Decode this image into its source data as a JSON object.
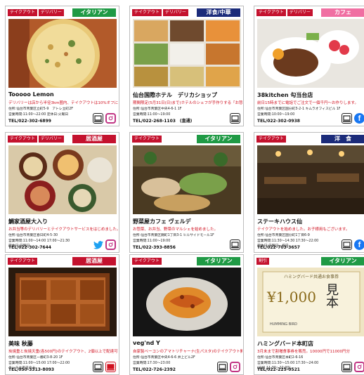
{
  "colors": {
    "tag": "#c4122e",
    "italian": "#1f9a45",
    "western_chinese": "#1b2b7a",
    "cafe": "#f06fa2",
    "izakaya": "#c4122e",
    "western": "#1b2b7a"
  },
  "cards": [
    {
      "tags": [
        "テイクアウト",
        "デリバリー"
      ],
      "category": "イタリアン",
      "name": "Tooooo Lemon",
      "desc": "デリバリーは店から半径3km圏内、テイクアウトは10%オフに。",
      "info": [
        "住所:仙台市青葉区立町5-9　アトレ立町2F",
        "営業時間:11:00〜22:00 定休日:火曜日"
      ],
      "tel": "TEL/022-302-6899",
      "icons": [
        "web-icon",
        "instagram-icon"
      ]
    },
    {
      "tags": [
        "テイクアウト",
        "デリバリー"
      ],
      "category": "洋食/中華",
      "name": "仙台国際ホテル　デリカショップ",
      "desc": "期間限定(5月31日(日)まで)ホテルのシェフが手作りする「お惣菜」販売中。",
      "info": [
        "住所:仙台市青葉区中央4-6-1 1F",
        "営業時間:11:00〜19:00"
      ],
      "tel": "TEL/022-268-1103　(直通)",
      "icons": [
        "web-icon"
      ]
    },
    {
      "tags": [
        "テイクアウト",
        "デリバリー"
      ],
      "category": "カフェ",
      "name": "38kitchen 勾当台店",
      "desc": "前日15時までに電話でご注文で一個千円〜お作りします。",
      "info": [
        "住所:仙台市青葉区国分町3-2-1 キムラオフィスビル 1F",
        "営業時間:10:00〜19:00"
      ],
      "tel": "TEL/022-302-0938",
      "icons": [
        "web-icon",
        "facebook-icon"
      ]
    },
    {
      "tags": [
        "テイクアウト",
        "デリバリー"
      ],
      "category": "居酒屋",
      "name": "鯛家酒屋大入り",
      "desc": "お弁当等のデリバリーとテイクアウトサービスをはじめました。",
      "info": [
        "住所:仙台市青葉区春日町4-5-30",
        "営業時間:11:00〜14:00 17:00〜21:30",
        "定休日:日曜日"
      ],
      "tel": "TEL/022-302-7644",
      "icons": [
        "twitter-icon",
        "instagram-icon"
      ]
    },
    {
      "tags": [
        "テイクアウト"
      ],
      "category": "イタリアン",
      "name": "野菜屋カフェ ヴェルデ",
      "desc": "お惣菜、お弁当、野菜のマルシェを始めました。",
      "info": [
        "住所:仙台市青葉区錦町1丁目3-1 ヒルサイドモール1F",
        "営業時間:11:00〜19:00"
      ],
      "tel": "TEL/022-393-8856",
      "icons": [
        "web-icon"
      ]
    },
    {
      "tags": [
        "テイクアウト"
      ],
      "category": "洋　食",
      "name": "ステーキハウス仙",
      "desc": "テイクアウトを始めました。お子様用もございます。",
      "info": [
        "住所:仙台市青葉区国分町1丁目6-9",
        "営業時間:11:30〜14:30 17:30〜22:00",
        "定休日:日曜日・祝日"
      ],
      "tel": "TEL/022-703-3657",
      "icons": [
        "web-icon",
        "facebook-icon"
      ]
    },
    {
      "tags": [
        "テイクアウト"
      ],
      "category": "居酒屋",
      "name": "美味 秋藤",
      "desc": "炭焼重と炭焼天重(各500円)のテイクアウト、2個以上で配達可能です！",
      "info": [
        "住所:仙台市青葉区一番町3-8-20 1F",
        "営業時間:11:00〜15:00 17:00〜22:00",
        "ランチは平日のみ"
      ],
      "tel": "TEL/050-3313-8093",
      "icons": [
        "web-icon",
        "web-red-icon"
      ]
    },
    {
      "tags": [
        "テイクアウト"
      ],
      "category": "イタリアン",
      "name": "veg'nd Y",
      "desc": "自家製ベーコンのアマトリチャーナ(生パスタ)のテイクアウト開始",
      "info": [
        "住所:仙台市青葉区中央4-6-6 井上ビル2F",
        "営業時間:17:30〜23:00"
      ],
      "tel": "TEL/022-726-2392",
      "icons": [
        "web-icon",
        "instagram-icon"
      ]
    },
    {
      "tags": [
        "割引"
      ],
      "category": "イタリアン",
      "name": "ハミングバード本町店",
      "desc": "3月末まで割増食事券を販売。10000円で11000円分",
      "info": [
        "住所:仙台市青葉区本町2-6-16",
        "営業時間:11:30〜15:00 17:30〜24:00",
        "(日祝 11:30〜22:00)"
      ],
      "tel": "TEL/022-225-0521",
      "icons": [
        "web-icon",
        "instagram-icon"
      ]
    }
  ],
  "voucher": {
    "yen": "¥1,000",
    "ji": "見本",
    "brand": "HUMMING BIRD",
    "header": "ハミングバード共通お食事券"
  }
}
